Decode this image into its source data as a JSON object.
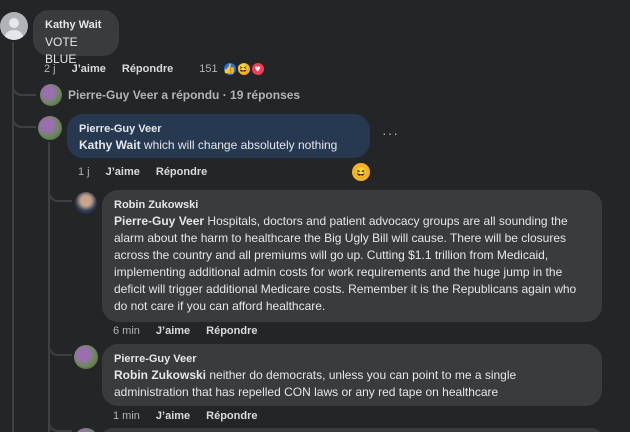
{
  "comments": [
    {
      "author": "Kathy Wait",
      "text": "VOTE BLUE",
      "time": "2 j",
      "like": "J’aime",
      "reply": "Répondre",
      "reaction_count": "151",
      "reactions": [
        "like-icon",
        "laugh-icon",
        "love-icon"
      ]
    },
    {
      "author": "Pierre-Guy Veer",
      "mention": "Kathy Wait",
      "text": " which will change absolutely nothing",
      "time": "1 j",
      "like": "J’aime",
      "reply": "Répondre",
      "reactions": [
        "laugh-icon"
      ]
    },
    {
      "author": "Robin Zukowski",
      "mention": "Pierre-Guy Veer",
      "text": " Hospitals, doctors and patient advocacy groups are all sounding the alarm about the harm to healthcare the Big Ugly Bill will cause. There will be closures across the country and all premiums will go up. Cutting $1.1 trillion from Medicaid, implementing additional admin costs for work requirements and the huge jump in the deficit will trigger additional Medicare costs. Remember it is the Republicans again who do not care if you can afford healthcare.",
      "time": "6 min",
      "like": "J’aime",
      "reply": "Répondre"
    },
    {
      "author": "Pierre-Guy Veer",
      "mention": "Robin Zukowski",
      "text": " neither do democrats, unless you can point to me a single administration that has repelled CON laws or any red tape on healthcare",
      "time": "1 min",
      "like": "J’aime",
      "reply": "Répondre"
    }
  ],
  "replies_summary": "Pierre-Guy Veer a répondu · 19 réponses",
  "more_options": "···"
}
